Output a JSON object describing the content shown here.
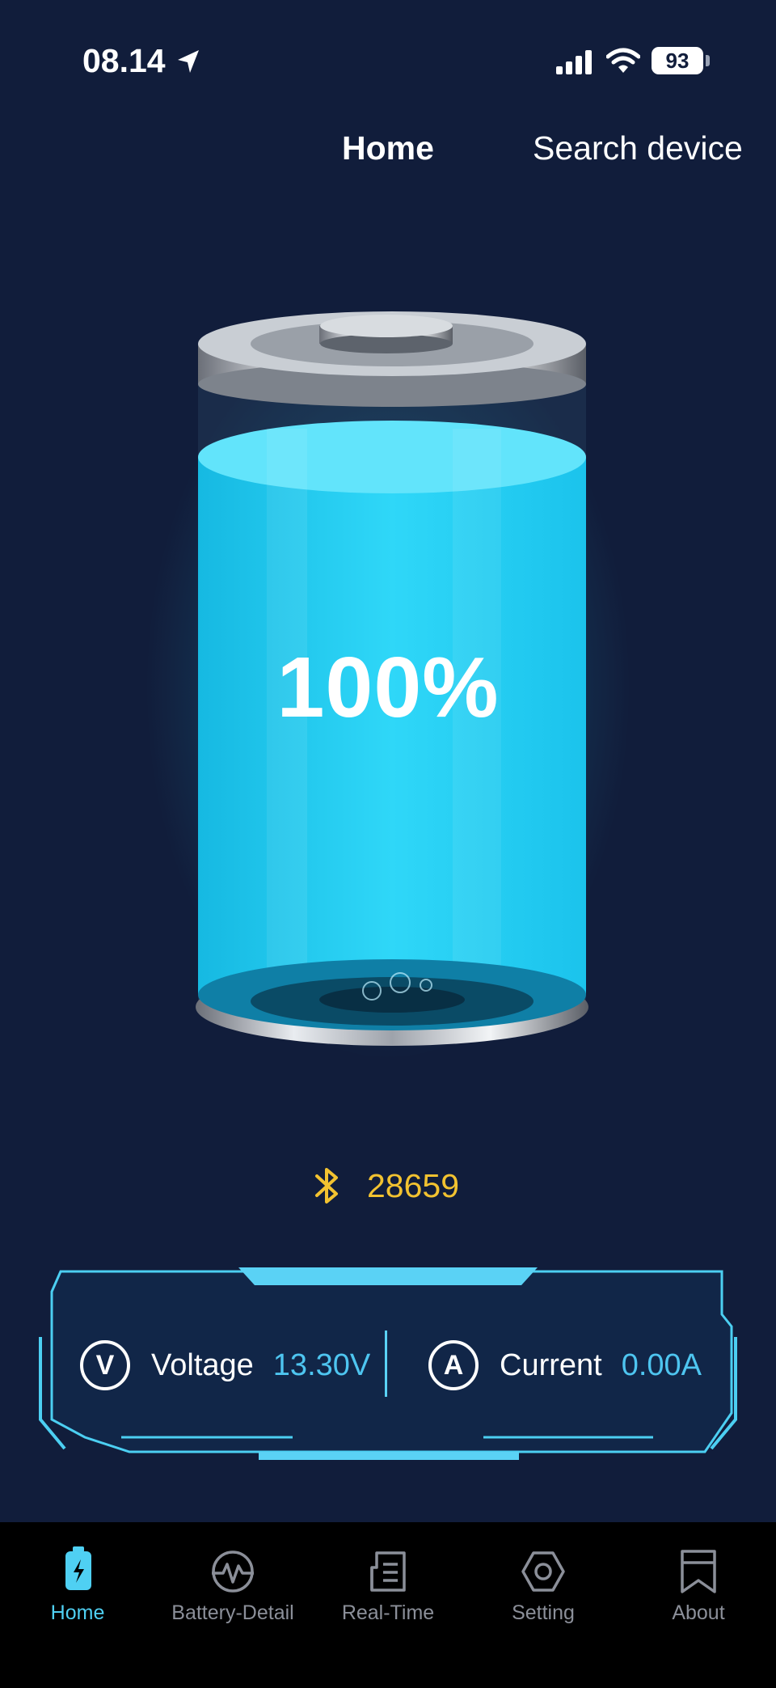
{
  "status_bar": {
    "time": "08.14",
    "battery_level": "93"
  },
  "top_nav": {
    "home": "Home",
    "search_device": "Search device"
  },
  "battery": {
    "percent_text": "100%",
    "level": 1.0,
    "fill_color": "#1ec8f0"
  },
  "device": {
    "bluetooth_id": "28659",
    "accent": "#f2c230"
  },
  "readings": {
    "voltage": {
      "icon_letter": "V",
      "label": "Voltage",
      "value": "13.30V"
    },
    "current": {
      "icon_letter": "A",
      "label": "Current",
      "value": "0.00A"
    }
  },
  "tabs": [
    {
      "label": "Home",
      "icon": "battery-bolt-icon",
      "active": true
    },
    {
      "label": "Battery-Detail",
      "icon": "pulse-circle-icon",
      "active": false
    },
    {
      "label": "Real-Time",
      "icon": "document-icon",
      "active": false
    },
    {
      "label": "Setting",
      "icon": "hexagon-gear-icon",
      "active": false
    },
    {
      "label": "About",
      "icon": "bookmark-icon",
      "active": false
    }
  ],
  "colors": {
    "background": "#111d3b",
    "accent_cyan": "#4fd0f3",
    "tabbar": "#000000"
  }
}
